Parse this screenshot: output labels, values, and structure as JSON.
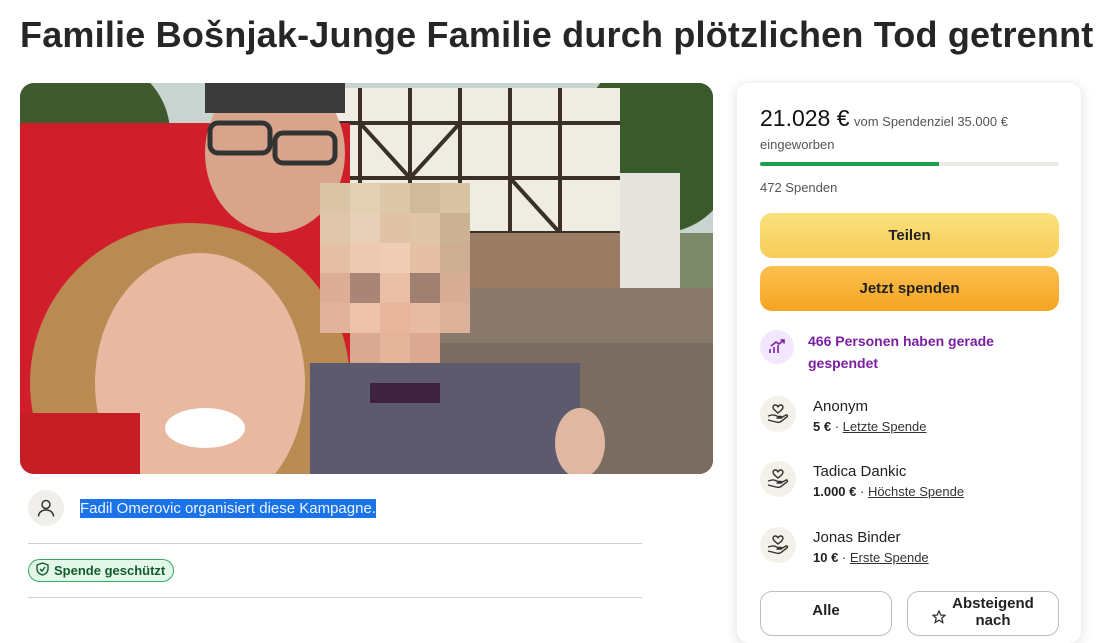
{
  "page": {
    "title": "Familie Bošnjak-Junge Familie durch plötzlichen Tod getrennt",
    "organizer_text": "Fadil Omerovic organisiert diese Kampagne.",
    "protected_label": "Spende geschützt"
  },
  "donation": {
    "raised": "21.028 €",
    "goal_text": "vom Spendenziel 35.000 € eingeworben",
    "progress_fraction": 0.6,
    "count_text": "472 Spenden",
    "share_label": "Teilen",
    "donate_label": "Jetzt spenden",
    "trend_text": "466 Personen haben gerade gespendet"
  },
  "donors": [
    {
      "name": "Anonym",
      "amount": "5 €",
      "tag": "Letzte Spende"
    },
    {
      "name": "Tadica Dankic",
      "amount": "1.000 €",
      "tag": "Höchste Spende"
    },
    {
      "name": "Jonas Binder",
      "amount": "10 €",
      "tag": "Erste Spende"
    }
  ],
  "filters": {
    "all_label": "Alle",
    "sort_label_line1": "Absteigend",
    "sort_label_line2": "nach"
  },
  "colors": {
    "progress": "#1a9e4b",
    "share_button": "#f7cd57",
    "donate_button": "#f6a424",
    "trend_text": "#7b1fa2",
    "protected_border": "#3aa865"
  }
}
